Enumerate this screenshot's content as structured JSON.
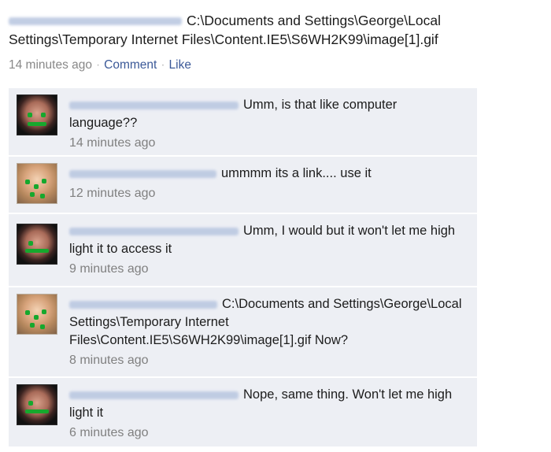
{
  "post": {
    "text": "C:\\Documents and Settings\\George\\Local Settings\\Temporary Internet Files\\Content.IE5\\S6WH2K99\\image[1].gif",
    "time": "14 minutes ago",
    "comment_label": "Comment",
    "like_label": "Like",
    "separator": "·"
  },
  "comments": [
    {
      "avatar": "avatar-anthony",
      "text": "Umm, is that like computer language??",
      "time": "14 minutes ago"
    },
    {
      "avatar": "avatar-kellie",
      "text": "ummmm its a link.... use it",
      "time": "12 minutes ago"
    },
    {
      "avatar": "avatar-anthony",
      "text": "Umm, I would but it won't let me high light it to access it",
      "time": "9 minutes ago"
    },
    {
      "avatar": "avatar-kellie",
      "text": "C:\\Documents and Settings\\George\\Local Settings\\Temporary Internet Files\\Content.IE5\\S6WH2K99\\image[1].gif Now?",
      "time": "8 minutes ago"
    },
    {
      "avatar": "avatar-anthony",
      "text": "Nope, same thing. Won't let me high light it",
      "time": "6 minutes ago"
    }
  ]
}
